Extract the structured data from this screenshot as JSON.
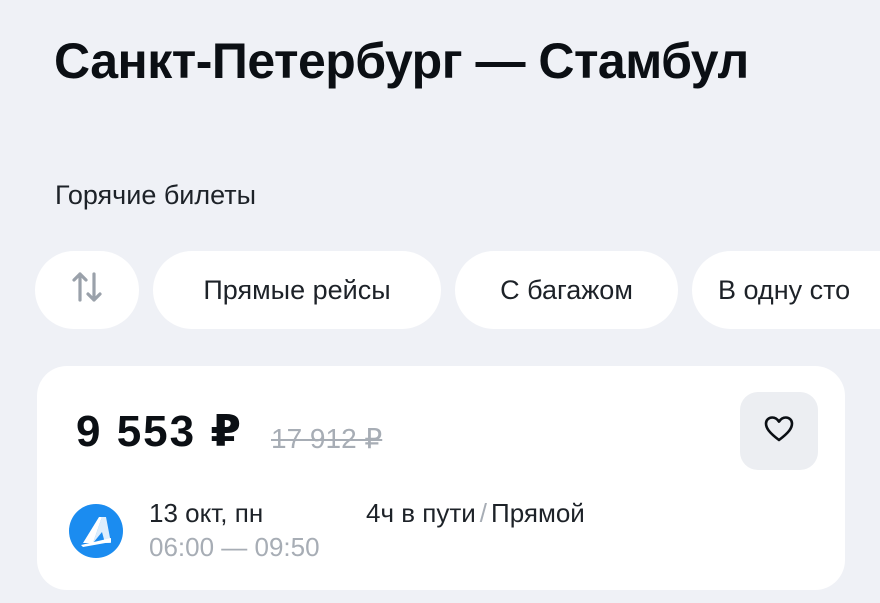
{
  "header": {
    "title": "Санкт-Петербург — Стамбул",
    "subtitle": "Горячие билеты"
  },
  "filters": {
    "sort_icon": "sort-arrows-icon",
    "items": [
      {
        "label": "Прямые рейсы"
      },
      {
        "label": "С багажом"
      },
      {
        "label": "В одну сто"
      }
    ]
  },
  "ticket": {
    "price": "9 553 ₽",
    "old_price": "17 912 ₽",
    "favorite_icon": "heart-icon",
    "airline_icon": "airline-logo-icon",
    "date": "13 окт, пн",
    "time": "06:00 — 09:50",
    "duration": "4ч в пути",
    "separator": "/",
    "stops": "Прямой"
  },
  "colors": {
    "background": "#eff1f6",
    "card": "#ffffff",
    "text": "#0b0f14",
    "muted": "#a7adb5",
    "airline_accent": "#1b8cf0"
  }
}
